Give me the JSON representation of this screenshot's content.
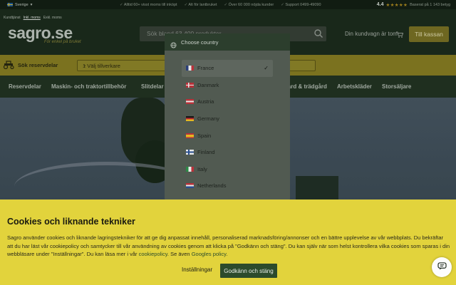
{
  "topbar": {
    "country": "Sverige",
    "usps": [
      "Alltid 60+ visst moms till inköpt",
      "Alt för lantbruket",
      "Över 60 000 nöjda kunder",
      "Support 0499-49090"
    ],
    "rating_value": "4.4",
    "rating_text": "Baserat på 1 143 betyg"
  },
  "header": {
    "subnav": [
      "Kundtjänst",
      "Inkl. moms",
      "Exkl. moms"
    ],
    "logo": "sagro.se",
    "slogan": "För enkel på bruket",
    "search_placeholder": "Sök bland 63 400 produkter",
    "cart_text": "Din kundvagn är tom",
    "checkout_label": "Till kassan"
  },
  "partbar": {
    "label": "Sök reservdelar",
    "vehicle_select": "1 Välj tillverkare"
  },
  "catnav": {
    "items": [
      {
        "label": "Reservdelar"
      },
      {
        "label": "Maskin- och traktortillbehör"
      },
      {
        "label": "Slitdelar"
      },
      {
        "label": "Hem, trädgård & trädgård"
      },
      {
        "label": "Arbetskläder"
      },
      {
        "label": "Storsäljare"
      }
    ]
  },
  "modal": {
    "title": "Choose country",
    "countries": [
      {
        "name": "France",
        "selected": true
      },
      {
        "name": "Danmark"
      },
      {
        "name": "Austria"
      },
      {
        "name": "Germany"
      },
      {
        "name": "Spain"
      },
      {
        "name": "Finland"
      },
      {
        "name": "Italy"
      },
      {
        "name": "Netherlands"
      }
    ],
    "check_glyph": "✓"
  },
  "cookie": {
    "title": "Cookies och liknande tekniker",
    "text_1": "Sagro använder cookies och liknande lagringstekniker för att ge dig anpassat innehåll, personaliserad marknadsföring/annonser och en bättre upplevelse av vår webbplats. Du bekräftar att du har läst vår cookiepolicy och samtycker till vår användning av cookies genom att klicka på \"Godkänn och stäng\". Du kan själv när som helst kontrollera vilka cookies som sparas i din webbläsare under \"Inställningar\". Du kan läsa mer i vår ",
    "link_1": "cookiepolicy",
    "text_2": ". Se även ",
    "link_2": "Googles policy",
    "text_3": ".",
    "settings_label": "Inställningar",
    "accept_label": "Godkänn och stäng"
  },
  "colors": {
    "accent_yellow": "#e2d33c",
    "brand_green": "#2c4b2c",
    "header_bg": "#1d2e1e"
  }
}
